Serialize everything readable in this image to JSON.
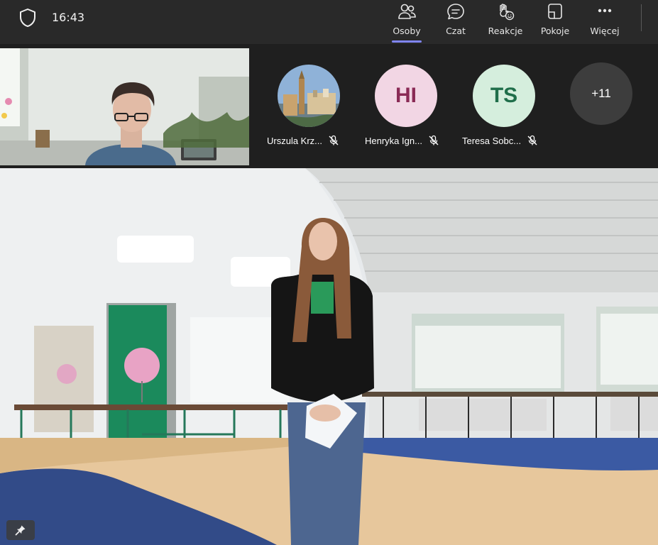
{
  "header": {
    "time": "16:43",
    "toolbar": [
      {
        "label": "Osoby",
        "icon": "people-icon",
        "active": true
      },
      {
        "label": "Czat",
        "icon": "chat-icon",
        "active": false
      },
      {
        "label": "Reakcje",
        "icon": "raise-hand-icon",
        "active": false
      },
      {
        "label": "Pokoje",
        "icon": "breakout-rooms-icon",
        "active": false
      },
      {
        "label": "Więcej",
        "icon": "more-icon",
        "active": false
      }
    ]
  },
  "participants": [
    {
      "name": "Urszula Krz...",
      "avatar": "photo",
      "muted": true
    },
    {
      "name": "Henryka Ign...",
      "initials": "HI",
      "avatar_bg": "#f2d6e4",
      "initials_color": "#8a2a55",
      "muted": true
    },
    {
      "name": "Teresa Sobc...",
      "initials": "TS",
      "avatar_bg": "#d5eedd",
      "initials_color": "#1f6e4a",
      "muted": true
    }
  ],
  "overflow_count": "+11",
  "colors": {
    "accent": "#7f85f5",
    "topbar": "#292929",
    "background": "#1f1f1f"
  }
}
